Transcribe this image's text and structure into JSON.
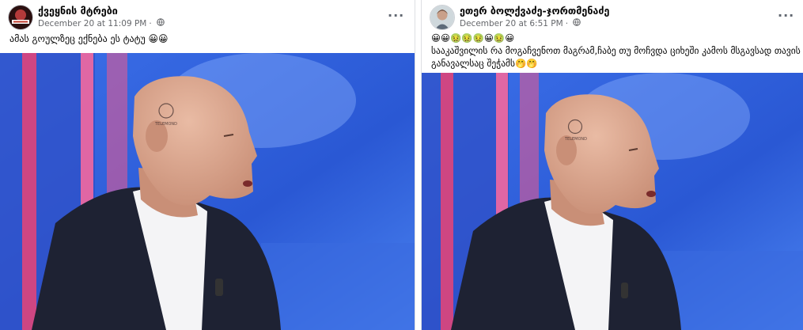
{
  "left_post": {
    "author": "ქვეყნის მტრები",
    "timestamp": "December 20 at 11:09 PM",
    "audience_icon": "globe-icon",
    "more_icon": "more-horizontal-icon",
    "caption": "ამას გოულზეც ექნება ეს ტატუ 😀😀",
    "image_watermark": "TELEMOND"
  },
  "right_post": {
    "author": "ეთერ ბოლქვაძე-ჯორთმენაძე",
    "timestamp": "December 20 at 6:51 PM",
    "audience_icon": "globe-icon",
    "more_icon": "more-horizontal-icon",
    "emoji_line": "😀😀🤢🤢🤢😀🤢😀",
    "caption_line1": "სააკაშვილის რა მოგაჩვენოთ მაგრამ,ჩაბე თუ მოჩვდა ციხეში კამოს მსგავსად თავის",
    "caption_line2": "განავალსაც შეჭამს🤭🤭",
    "image_watermark": "TELEMOND"
  },
  "colors": {
    "studio_blue": "#2d63db",
    "studio_pink": "#e0457a",
    "jacket": "#1e2233",
    "skin": "#d8a48c",
    "shirt": "#f4f4f6"
  }
}
